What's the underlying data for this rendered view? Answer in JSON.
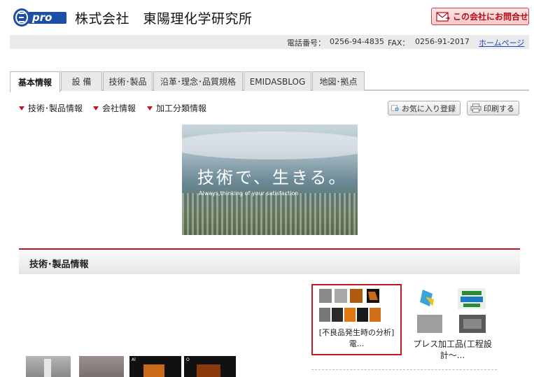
{
  "header": {
    "logo_text": "pro",
    "company_name": "株式会社　東陽理化学研究所",
    "contact_button": "この会社にお問合せ"
  },
  "infobar": {
    "phone_label": "電話番号：",
    "phone": "0256-94-4835",
    "fax_label": "FAX：",
    "fax": "0256-91-2017",
    "homepage": "ホームページ"
  },
  "tabs": [
    {
      "label": "基本情報",
      "active": true
    },
    {
      "label": "設 備"
    },
    {
      "label": "技術･製品"
    },
    {
      "label": "沿革･理念･品質規格"
    },
    {
      "label": "EMIDASBLOG"
    },
    {
      "label": "地図･拠点"
    }
  ],
  "subnav": [
    {
      "label": "技術･製品情報"
    },
    {
      "label": "会社情報"
    },
    {
      "label": "加工分類情報"
    }
  ],
  "utility": {
    "favorite": "お気に入り登録",
    "print": "印刷する"
  },
  "hero": {
    "main_text": "技術で、生きる。",
    "sub_text": "Always,thinking of your satisfaction"
  },
  "section": {
    "title": "技術･製品情報"
  },
  "products": [
    {
      "caption_line1": "[不良品発生時の分析]",
      "caption_line2": "電..."
    },
    {
      "caption_line1": "プレス加工品(工程設",
      "caption_line2": "計～..."
    }
  ],
  "bottom_thumbs": [
    {
      "label": ""
    },
    {
      "label": ""
    },
    {
      "label": "Al"
    },
    {
      "label": "O"
    }
  ],
  "colors": {
    "accent_red": "#b81c22",
    "link_blue": "#1a48b8",
    "logo_blue": "#1d4fa8"
  }
}
